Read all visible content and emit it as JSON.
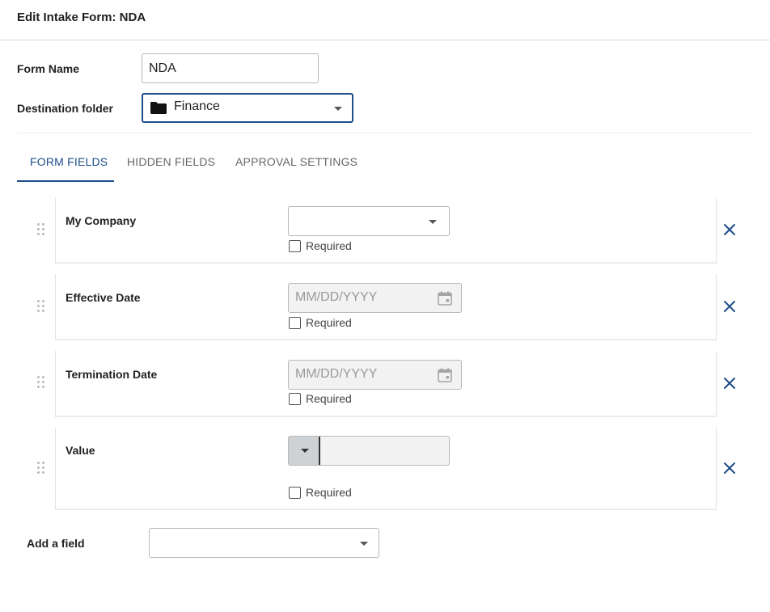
{
  "header": {
    "title": "Edit Intake Form: NDA"
  },
  "form": {
    "name_label": "Form Name",
    "name_value": "NDA",
    "destination_label": "Destination folder",
    "destination_value": "Finance",
    "destination_icon": "folder-icon"
  },
  "tabs": [
    {
      "label": "FORM FIELDS",
      "active": true
    },
    {
      "label": "HIDDEN FIELDS",
      "active": false
    },
    {
      "label": "APPROVAL SETTINGS",
      "active": false
    }
  ],
  "fields": [
    {
      "label": "My Company",
      "type": "select",
      "value": "",
      "required_label": "Required",
      "required": false
    },
    {
      "label": "Effective Date",
      "type": "date",
      "placeholder": "MM/DD/YYYY",
      "required_label": "Required",
      "required": false
    },
    {
      "label": "Termination Date",
      "type": "date",
      "placeholder": "MM/DD/YYYY",
      "required_label": "Required",
      "required": false
    },
    {
      "label": "Value",
      "type": "currency",
      "value": "",
      "required_label": "Required",
      "required": false
    }
  ],
  "add_field": {
    "label": "Add a field",
    "value": ""
  },
  "colors": {
    "accent": "#1d4e89",
    "disabled_bg": "#f2f2f2",
    "border": "#b9b9b9"
  }
}
